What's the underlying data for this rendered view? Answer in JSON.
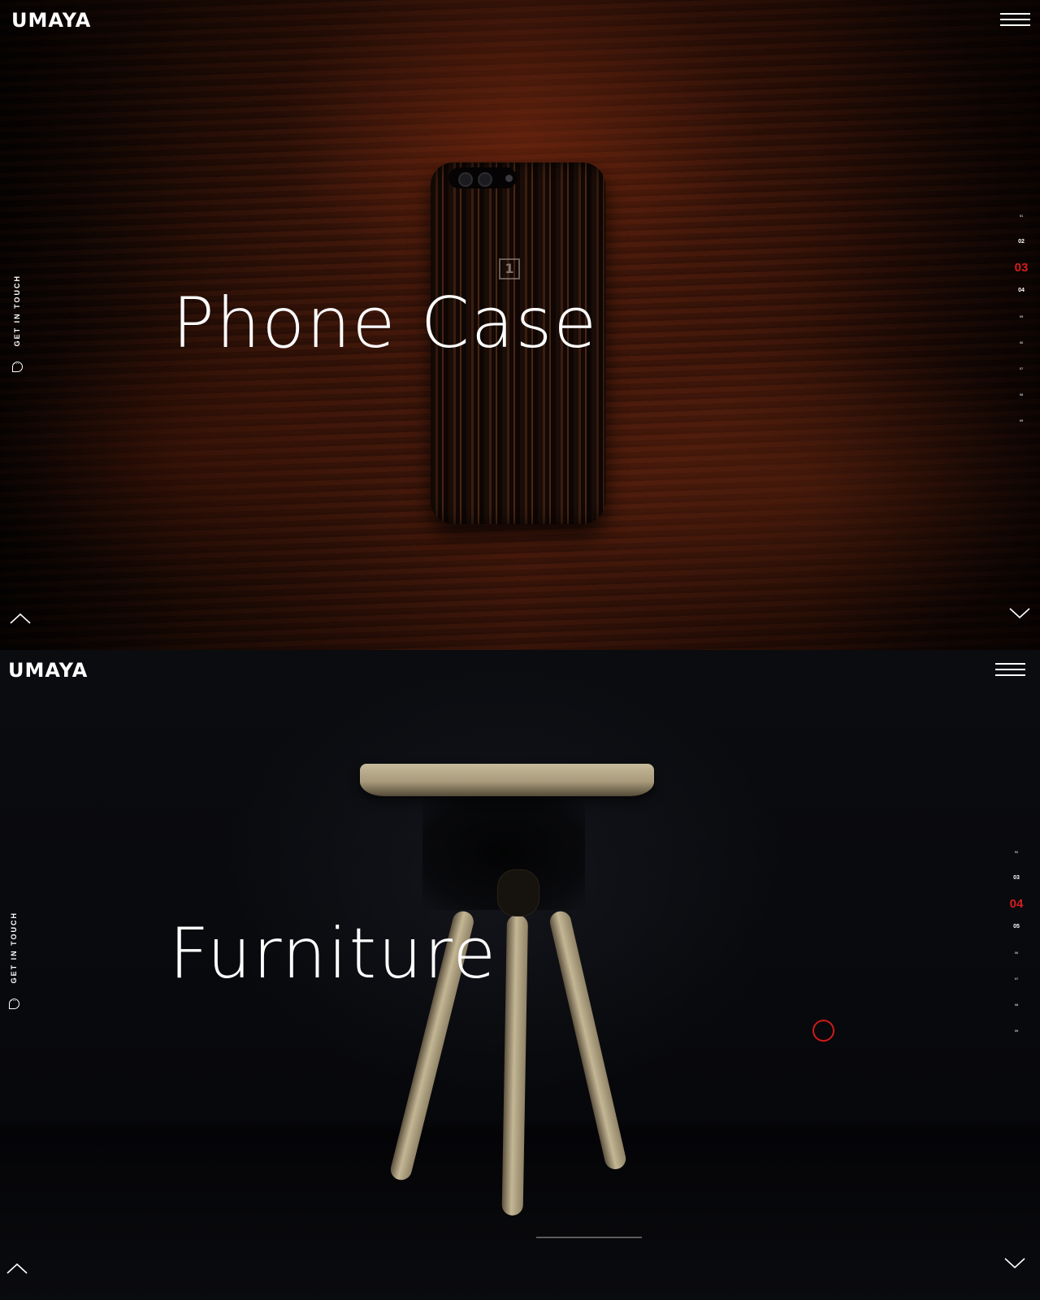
{
  "slides": [
    {
      "brand": "UMAYA",
      "title": "Phone Case",
      "touch_label": "GET IN TOUCH",
      "pager": [
        {
          "label": "01",
          "state": "dim"
        },
        {
          "label": "02",
          "state": "normal"
        },
        {
          "label": "03",
          "state": "active"
        },
        {
          "label": "04",
          "state": "normal"
        },
        {
          "label": "05",
          "state": "dim"
        },
        {
          "label": "06",
          "state": "dim"
        },
        {
          "label": "07",
          "state": "dim"
        },
        {
          "label": "08",
          "state": "dim"
        },
        {
          "label": "09",
          "state": "dim"
        }
      ]
    },
    {
      "brand": "UMAYA",
      "title": "Furniture",
      "touch_label": "GET IN TOUCH",
      "pager": [
        {
          "label": "02",
          "state": "dim"
        },
        {
          "label": "03",
          "state": "normal"
        },
        {
          "label": "04",
          "state": "active"
        },
        {
          "label": "05",
          "state": "normal"
        },
        {
          "label": "06",
          "state": "dim"
        },
        {
          "label": "07",
          "state": "dim"
        },
        {
          "label": "08",
          "state": "dim"
        },
        {
          "label": "09",
          "state": "dim"
        }
      ]
    }
  ],
  "colors": {
    "accent": "#d31f1f",
    "text": "#ffffff"
  },
  "icons": {
    "menu": "hamburger-icon",
    "touch": "chat-bubble-icon",
    "up": "chevron-up-icon",
    "down": "chevron-down-icon"
  }
}
